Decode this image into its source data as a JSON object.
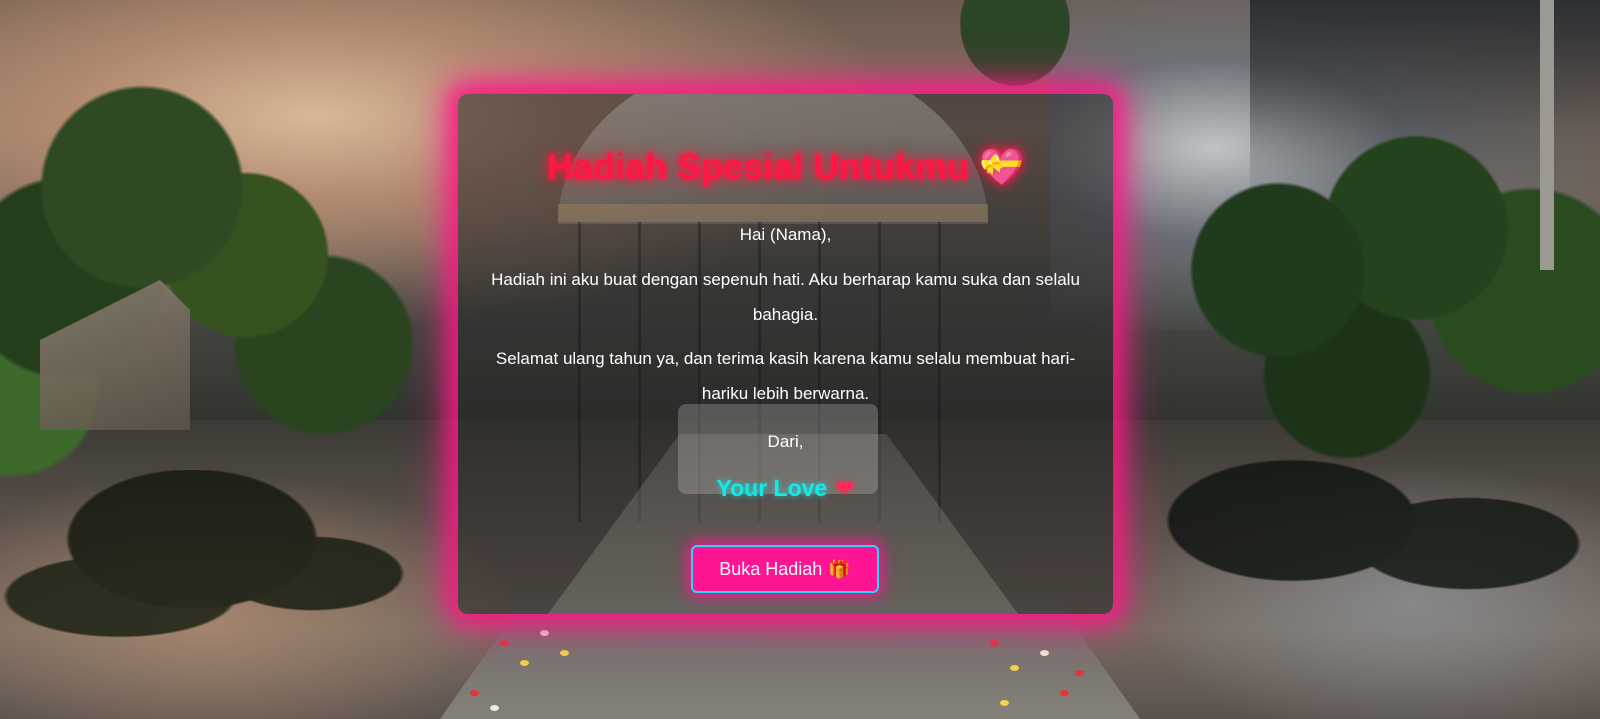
{
  "card": {
    "title": "Hadiah Spesial Untukmu",
    "title_icon": "💝",
    "greeting": "Hai (Nama),",
    "paragraph_1": "Hadiah ini aku buat dengan sepenuh hati. Aku berharap kamu suka dan selalu bahagia.",
    "paragraph_2": "Selamat ulang tahun ya, dan terima kasih karena kamu selalu membuat hari-hariku lebih berwarna.",
    "from_label": "Dari,",
    "signature": "Your Love",
    "signature_icon": "❤",
    "button_label": "Buka Hadiah",
    "button_icon": "🎁"
  },
  "colors": {
    "title": "#ff1744",
    "signature": "#14e9e9",
    "button_bg": "#ff1493",
    "button_border": "#28d6ff",
    "card_glow": "#ff1482"
  }
}
